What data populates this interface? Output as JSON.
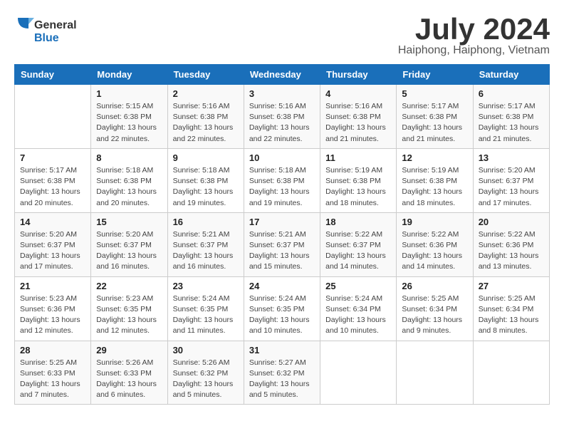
{
  "header": {
    "logo_line1": "General",
    "logo_line2": "Blue",
    "month_year": "July 2024",
    "location": "Haiphong, Haiphong, Vietnam"
  },
  "days_of_week": [
    "Sunday",
    "Monday",
    "Tuesday",
    "Wednesday",
    "Thursday",
    "Friday",
    "Saturday"
  ],
  "weeks": [
    [
      {
        "day": "",
        "info": ""
      },
      {
        "day": "1",
        "info": "Sunrise: 5:15 AM\nSunset: 6:38 PM\nDaylight: 13 hours and 22 minutes."
      },
      {
        "day": "2",
        "info": "Sunrise: 5:16 AM\nSunset: 6:38 PM\nDaylight: 13 hours and 22 minutes."
      },
      {
        "day": "3",
        "info": "Sunrise: 5:16 AM\nSunset: 6:38 PM\nDaylight: 13 hours and 22 minutes."
      },
      {
        "day": "4",
        "info": "Sunrise: 5:16 AM\nSunset: 6:38 PM\nDaylight: 13 hours and 21 minutes."
      },
      {
        "day": "5",
        "info": "Sunrise: 5:17 AM\nSunset: 6:38 PM\nDaylight: 13 hours and 21 minutes."
      },
      {
        "day": "6",
        "info": "Sunrise: 5:17 AM\nSunset: 6:38 PM\nDaylight: 13 hours and 21 minutes."
      }
    ],
    [
      {
        "day": "7",
        "info": "Sunrise: 5:17 AM\nSunset: 6:38 PM\nDaylight: 13 hours and 20 minutes."
      },
      {
        "day": "8",
        "info": "Sunrise: 5:18 AM\nSunset: 6:38 PM\nDaylight: 13 hours and 20 minutes."
      },
      {
        "day": "9",
        "info": "Sunrise: 5:18 AM\nSunset: 6:38 PM\nDaylight: 13 hours and 19 minutes."
      },
      {
        "day": "10",
        "info": "Sunrise: 5:18 AM\nSunset: 6:38 PM\nDaylight: 13 hours and 19 minutes."
      },
      {
        "day": "11",
        "info": "Sunrise: 5:19 AM\nSunset: 6:38 PM\nDaylight: 13 hours and 18 minutes."
      },
      {
        "day": "12",
        "info": "Sunrise: 5:19 AM\nSunset: 6:38 PM\nDaylight: 13 hours and 18 minutes."
      },
      {
        "day": "13",
        "info": "Sunrise: 5:20 AM\nSunset: 6:37 PM\nDaylight: 13 hours and 17 minutes."
      }
    ],
    [
      {
        "day": "14",
        "info": "Sunrise: 5:20 AM\nSunset: 6:37 PM\nDaylight: 13 hours and 17 minutes."
      },
      {
        "day": "15",
        "info": "Sunrise: 5:20 AM\nSunset: 6:37 PM\nDaylight: 13 hours and 16 minutes."
      },
      {
        "day": "16",
        "info": "Sunrise: 5:21 AM\nSunset: 6:37 PM\nDaylight: 13 hours and 16 minutes."
      },
      {
        "day": "17",
        "info": "Sunrise: 5:21 AM\nSunset: 6:37 PM\nDaylight: 13 hours and 15 minutes."
      },
      {
        "day": "18",
        "info": "Sunrise: 5:22 AM\nSunset: 6:37 PM\nDaylight: 13 hours and 14 minutes."
      },
      {
        "day": "19",
        "info": "Sunrise: 5:22 AM\nSunset: 6:36 PM\nDaylight: 13 hours and 14 minutes."
      },
      {
        "day": "20",
        "info": "Sunrise: 5:22 AM\nSunset: 6:36 PM\nDaylight: 13 hours and 13 minutes."
      }
    ],
    [
      {
        "day": "21",
        "info": "Sunrise: 5:23 AM\nSunset: 6:36 PM\nDaylight: 13 hours and 12 minutes."
      },
      {
        "day": "22",
        "info": "Sunrise: 5:23 AM\nSunset: 6:35 PM\nDaylight: 13 hours and 12 minutes."
      },
      {
        "day": "23",
        "info": "Sunrise: 5:24 AM\nSunset: 6:35 PM\nDaylight: 13 hours and 11 minutes."
      },
      {
        "day": "24",
        "info": "Sunrise: 5:24 AM\nSunset: 6:35 PM\nDaylight: 13 hours and 10 minutes."
      },
      {
        "day": "25",
        "info": "Sunrise: 5:24 AM\nSunset: 6:34 PM\nDaylight: 13 hours and 10 minutes."
      },
      {
        "day": "26",
        "info": "Sunrise: 5:25 AM\nSunset: 6:34 PM\nDaylight: 13 hours and 9 minutes."
      },
      {
        "day": "27",
        "info": "Sunrise: 5:25 AM\nSunset: 6:34 PM\nDaylight: 13 hours and 8 minutes."
      }
    ],
    [
      {
        "day": "28",
        "info": "Sunrise: 5:25 AM\nSunset: 6:33 PM\nDaylight: 13 hours and 7 minutes."
      },
      {
        "day": "29",
        "info": "Sunrise: 5:26 AM\nSunset: 6:33 PM\nDaylight: 13 hours and 6 minutes."
      },
      {
        "day": "30",
        "info": "Sunrise: 5:26 AM\nSunset: 6:32 PM\nDaylight: 13 hours and 5 minutes."
      },
      {
        "day": "31",
        "info": "Sunrise: 5:27 AM\nSunset: 6:32 PM\nDaylight: 13 hours and 5 minutes."
      },
      {
        "day": "",
        "info": ""
      },
      {
        "day": "",
        "info": ""
      },
      {
        "day": "",
        "info": ""
      }
    ]
  ]
}
